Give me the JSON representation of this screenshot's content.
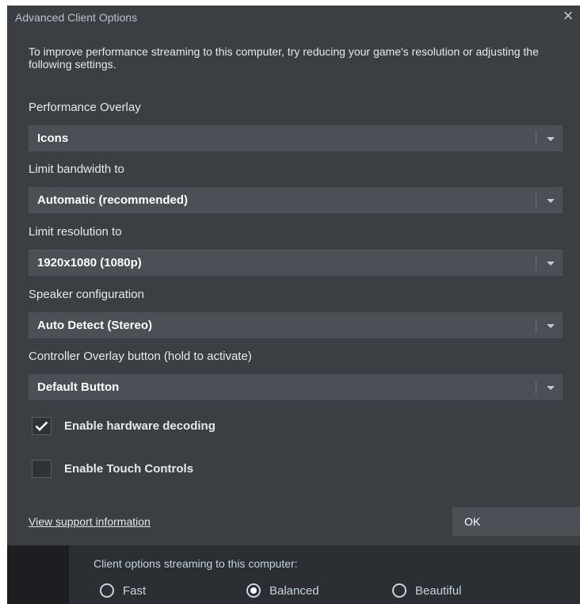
{
  "dialog": {
    "title": "Advanced Client Options",
    "close_icon": "×",
    "intro": "To improve performance streaming to this computer, try reducing your game's resolution or adjusting the following settings."
  },
  "fields": [
    {
      "label": "Performance Overlay",
      "value": "Icons"
    },
    {
      "label": "Limit bandwidth to",
      "value": "Automatic (recommended)"
    },
    {
      "label": "Limit resolution to",
      "value": "1920x1080 (1080p)"
    },
    {
      "label": "Speaker configuration",
      "value": "Auto Detect (Stereo)"
    },
    {
      "label": "Controller Overlay button (hold to activate)",
      "value": "Default Button"
    }
  ],
  "checkboxes": [
    {
      "label": "Enable hardware decoding",
      "checked": true
    },
    {
      "label": "Enable Touch Controls",
      "checked": false
    }
  ],
  "footer": {
    "support_link": "View support information",
    "ok_label": "OK"
  },
  "background_window": {
    "title": "Client options streaming to this computer:",
    "options": [
      {
        "label": "Fast",
        "selected": false
      },
      {
        "label": "Balanced",
        "selected": true
      },
      {
        "label": "Beautiful",
        "selected": false
      }
    ]
  },
  "colors": {
    "dialog_bg": "#3b3e43",
    "control_bg": "#4b4f56",
    "text": "#e6e9ec",
    "backdrop_bg": "#2b2e33"
  }
}
